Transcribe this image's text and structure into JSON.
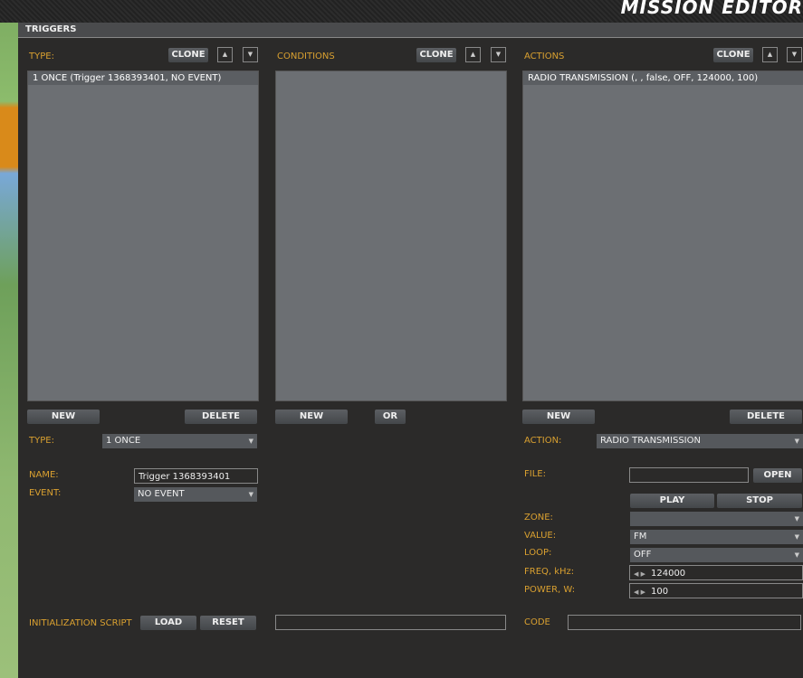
{
  "window": {
    "title": "MISSION EDITOR",
    "section": "TRIGGERS"
  },
  "type_col": {
    "label": "TYPE:",
    "clone": "CLONE",
    "items": [
      "1 ONCE (Trigger 1368393401, NO EVENT)"
    ],
    "new": "NEW",
    "delete": "DELETE"
  },
  "conditions_col": {
    "label": "CONDITIONS",
    "clone": "CLONE",
    "new": "NEW",
    "or": "OR"
  },
  "actions_col": {
    "label": "ACTIONS",
    "clone": "CLONE",
    "items": [
      "RADIO TRANSMISSION (, , false, OFF, 124000, 100)"
    ],
    "new": "NEW",
    "delete": "DELETE"
  },
  "trigger_form": {
    "type_label": "TYPE:",
    "type_value": "1 ONCE",
    "name_label": "NAME:",
    "name_value": "Trigger 1368393401",
    "event_label": "EVENT:",
    "event_value": "NO EVENT"
  },
  "action_form": {
    "action_label": "ACTION:",
    "action_value": "RADIO TRANSMISSION",
    "file_label": "FILE:",
    "file_value": "",
    "open": "OPEN",
    "play": "PLAY",
    "stop": "STOP",
    "zone_label": "ZONE:",
    "zone_value": "",
    "value_label": "VALUE:",
    "value_value": "FM",
    "loop_label": "LOOP:",
    "loop_value": "OFF",
    "freq_label": "FREQ, kHz:",
    "freq_value": "124000",
    "power_label": "POWER, W:",
    "power_value": "100"
  },
  "bottom": {
    "init_label": "INITIALIZATION SCRIPT",
    "load": "LOAD",
    "reset": "RESET",
    "init_value": "",
    "code_label": "CODE",
    "code_value": ""
  }
}
